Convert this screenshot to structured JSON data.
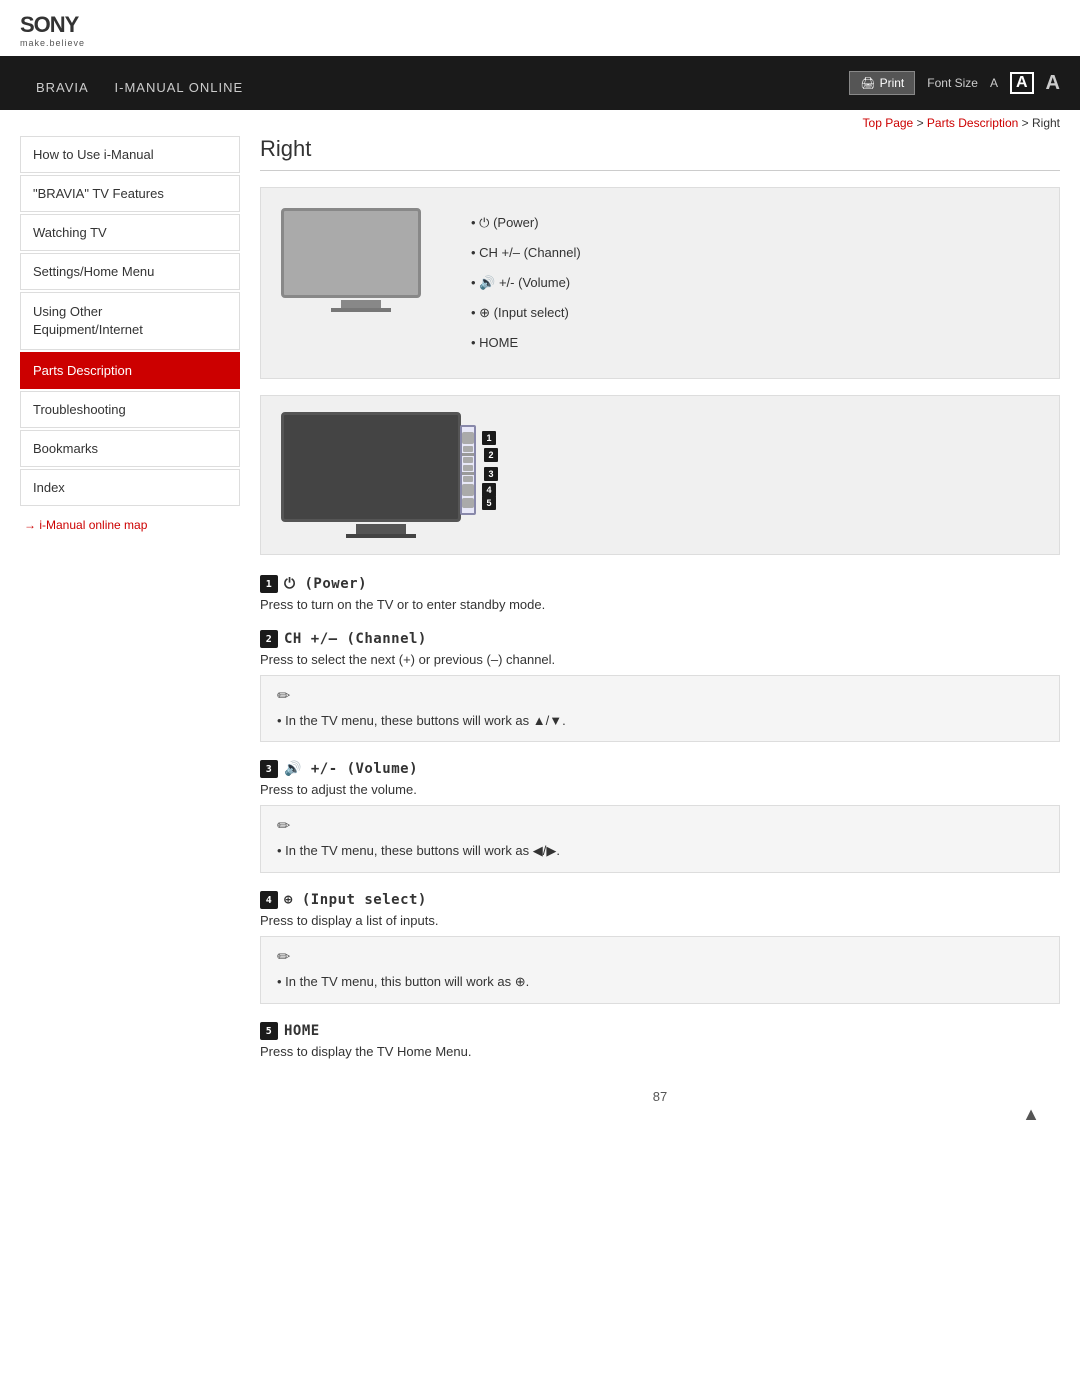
{
  "header": {
    "logo": "BRAVIA",
    "subtitle": "i-Manual online",
    "print_label": "Print",
    "font_size_label": "Font Size",
    "font_a_small": "A",
    "font_a_medium": "A",
    "font_a_large": "A"
  },
  "sony": {
    "name": "SONY",
    "tagline": "make.believe"
  },
  "breadcrumb": {
    "top_page": "Top Page",
    "parts_description": "Parts Description",
    "current": "Right",
    "sep1": " > ",
    "sep2": " > "
  },
  "sidebar": {
    "items": [
      {
        "label": "How to Use i-Manual",
        "active": false
      },
      {
        "label": "\"BRAVIA\" TV Features",
        "active": false
      },
      {
        "label": "Watching TV",
        "active": false
      },
      {
        "label": "Settings/Home Menu",
        "active": false
      },
      {
        "label": "Using Other Equipment/Internet",
        "active": false
      },
      {
        "label": "Parts Description",
        "active": true
      },
      {
        "label": "Troubleshooting",
        "active": false
      },
      {
        "label": "Bookmarks",
        "active": false
      },
      {
        "label": "Index",
        "active": false
      }
    ],
    "map_link": "i-Manual online map"
  },
  "page": {
    "title": "Right",
    "overview": {
      "bullets": [
        "⏻ (Power)",
        "CH +/– (Channel)",
        "🔊 +/- (Volume)",
        "⊕ (Input select)",
        "HOME"
      ]
    },
    "sections": [
      {
        "num": "1",
        "heading": "⏻ (Power)",
        "desc": "Press to turn on the TV or to enter standby mode."
      },
      {
        "num": "2",
        "heading": "CH +/– (Channel)",
        "desc": "Press to select the next (+) or previous (–) channel.",
        "note": "In the TV menu, these buttons will work as ▲/▼."
      },
      {
        "num": "3",
        "heading": "🔊 +/- (Volume)",
        "desc": "Press to adjust the volume.",
        "note": "In the TV menu, these buttons will work as ◀/▶."
      },
      {
        "num": "4",
        "heading": "⊕ (Input select)",
        "desc": "Press to display a list of inputs.",
        "note": "In the TV menu, this button will work as ⊕."
      },
      {
        "num": "5",
        "heading": "HOME",
        "desc": "Press to display the TV Home Menu."
      }
    ],
    "page_number": "87"
  }
}
